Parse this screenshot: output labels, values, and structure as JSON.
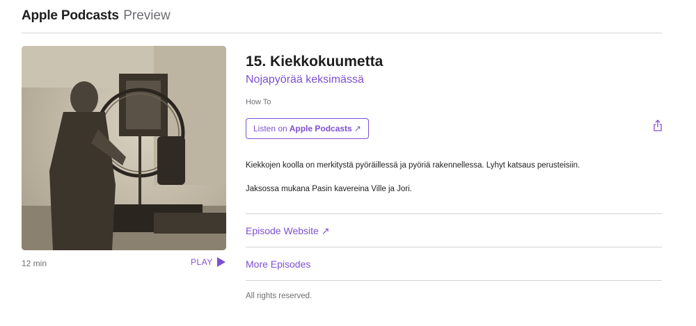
{
  "header": {
    "brand": "Apple Podcasts",
    "brand_sub": "Preview"
  },
  "artwork": {
    "alt_icon": "podcast-artwork-photo"
  },
  "player": {
    "duration": "12 min",
    "play_label": "PLAY"
  },
  "episode": {
    "title": "15. Kiekkokuumetta",
    "show_name": "Nojapyörää keksimässä",
    "category": "How To",
    "listen_prefix": "Listen on",
    "listen_brand": "Apple Podcasts",
    "listen_arrow": "↗",
    "description": [
      "Kiekkojen koolla on merkitystä pyöräillessä ja pyöriä rakennellessa. Lyhyt katsaus perusteisiin.",
      "Jaksossa mukana Pasin kavereina Ville ja Jori."
    ]
  },
  "links": {
    "episode_website": "Episode Website ↗",
    "more_episodes": "More Episodes"
  },
  "footer": {
    "copyright": "All rights reserved."
  },
  "colors": {
    "accent": "#7d4fd1",
    "text": "#1d1d1f",
    "muted": "#6e6e73",
    "divider": "#d2d2d7"
  }
}
